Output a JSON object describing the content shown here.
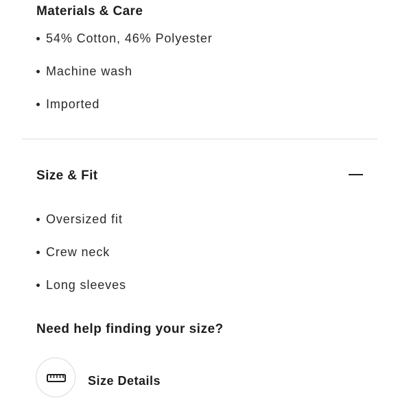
{
  "materials_care": {
    "title": "Materials & Care",
    "items": [
      {
        "label": "54% Cotton, 46% Polyester"
      },
      {
        "label": "Machine wash"
      },
      {
        "label": "Imported"
      }
    ]
  },
  "size_fit": {
    "title": "Size & Fit",
    "expanded": true,
    "toggle_icon": "minus-icon",
    "items": [
      {
        "label": "Oversized fit"
      },
      {
        "label": "Crew neck"
      },
      {
        "label": "Long sleeves"
      }
    ]
  },
  "size_help": {
    "heading": "Need help finding your size?",
    "link_icon": "ruler-icon",
    "link_label": "Size Details"
  }
}
